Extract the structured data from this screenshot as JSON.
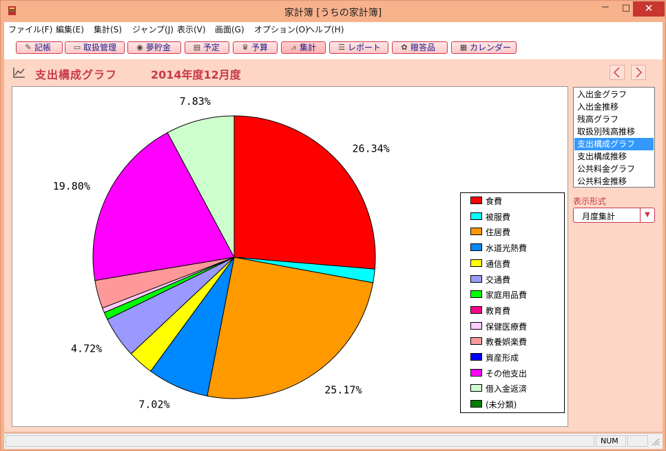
{
  "window": {
    "title": "家計簿 [うちの家計簿]",
    "min_label": "－",
    "max_label": "□",
    "close_label": "✕"
  },
  "menu": [
    "ファイル(F)",
    "編集(E)",
    "集計(S)",
    "ジャンプ(J)",
    "表示(V)",
    "画面(G)",
    "オプション(O)",
    "ヘルプ(H)"
  ],
  "toolbar": [
    {
      "label": "記帳",
      "icon": "pencil-icon",
      "glyph": "✎"
    },
    {
      "label": "取扱管理",
      "icon": "card-icon",
      "glyph": "▭"
    },
    {
      "label": "夢貯金",
      "icon": "piggy-bank-icon",
      "glyph": "◉"
    },
    {
      "label": "予定",
      "icon": "schedule-icon",
      "glyph": "▤"
    },
    {
      "label": "予算",
      "icon": "budget-icon",
      "glyph": "♛"
    },
    {
      "label": "集計",
      "icon": "chart-icon",
      "glyph": "⩘"
    },
    {
      "label": "レポート",
      "icon": "report-icon",
      "glyph": "☰"
    },
    {
      "label": "贈答品",
      "icon": "gift-icon",
      "glyph": "✿"
    },
    {
      "label": "カレンダー",
      "icon": "calendar-icon",
      "glyph": "▦"
    }
  ],
  "header": {
    "title": "支出構成グラフ",
    "period": "2014年度12月度"
  },
  "side_list": {
    "items": [
      "入出金グラフ",
      "入出金推移",
      "残高グラフ",
      "取扱別残高推移",
      "支出構成グラフ",
      "支出構成推移",
      "公共料金グラフ",
      "公共料金推移"
    ],
    "selected": "支出構成グラフ"
  },
  "display": {
    "label": "表示形式",
    "value": "月度集計"
  },
  "status": {
    "num": "NUM"
  },
  "chart_data": {
    "type": "pie",
    "start_angle_deg": 0,
    "direction": "clockwise",
    "slices": [
      {
        "name": "食費",
        "value": 26.34,
        "color": "#ff0000",
        "label": "26.34%"
      },
      {
        "name": "被服費",
        "value": 1.55,
        "color": "#00ffff",
        "label": ""
      },
      {
        "name": "住居費",
        "value": 25.17,
        "color": "#ff9900",
        "label": "25.17%"
      },
      {
        "name": "水道光熱費",
        "value": 7.02,
        "color": "#0088ff",
        "label": "7.02%"
      },
      {
        "name": "通信費",
        "value": 2.95,
        "color": "#ffff00",
        "label": ""
      },
      {
        "name": "交通費",
        "value": 4.72,
        "color": "#9999ff",
        "label": "4.72%"
      },
      {
        "name": "家庭用品費",
        "value": 0.85,
        "color": "#00ff00",
        "label": ""
      },
      {
        "name": "教育費",
        "value": 0.0,
        "color": "#ff0088",
        "label": ""
      },
      {
        "name": "保健医療費",
        "value": 0.55,
        "color": "#ffccff",
        "label": ""
      },
      {
        "name": "教養娯楽費",
        "value": 3.22,
        "color": "#ff9999",
        "label": ""
      },
      {
        "name": "資産形成",
        "value": 0.0,
        "color": "#0000ff",
        "label": ""
      },
      {
        "name": "その他支出",
        "value": 19.8,
        "color": "#ff00ff",
        "label": "19.80%"
      },
      {
        "name": "借入金返済",
        "value": 7.83,
        "color": "#ccffcc",
        "label": "7.83%"
      },
      {
        "name": "(未分類)",
        "value": 0.0,
        "color": "#008000",
        "label": ""
      }
    ]
  }
}
